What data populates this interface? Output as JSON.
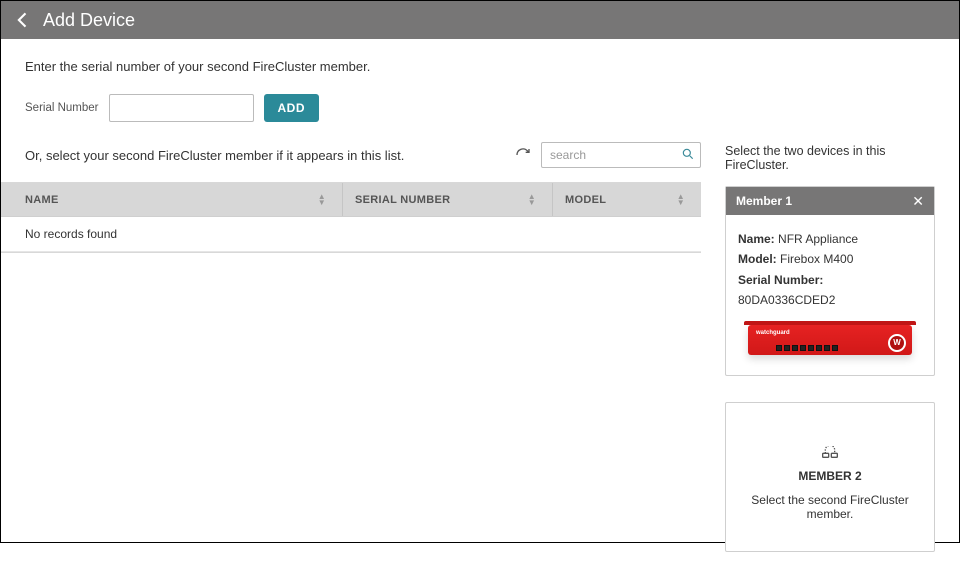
{
  "header": {
    "title": "Add Device"
  },
  "instruction": "Enter the serial number of your second FireCluster member.",
  "serial": {
    "label": "Serial Number",
    "value": "",
    "add_label": "ADD"
  },
  "or_text": "Or, select your second FireCluster member if it appears in this list.",
  "search": {
    "placeholder": "search",
    "value": ""
  },
  "table": {
    "columns": {
      "name": "NAME",
      "serial": "SERIAL NUMBER",
      "model": "MODEL"
    },
    "empty": "No records found"
  },
  "right": {
    "instruction": "Select the two devices in this FireCluster.",
    "member1": {
      "header": "Member 1",
      "name_label": "Name:",
      "name_value": "NFR Appliance",
      "model_label": "Model:",
      "model_value": "Firebox M400",
      "serial_label": "Serial Number:",
      "serial_value": "80DA0336CDED2"
    },
    "member2": {
      "title": "MEMBER 2",
      "text": "Select the second FireCluster member."
    }
  }
}
